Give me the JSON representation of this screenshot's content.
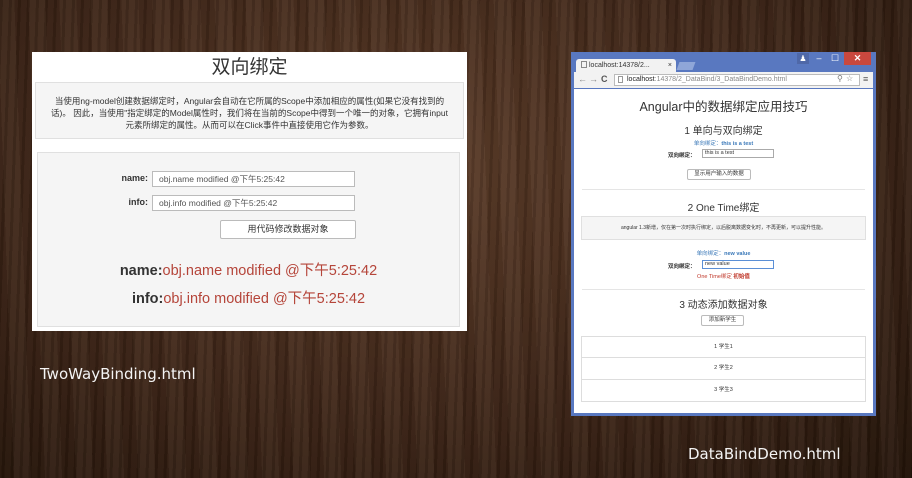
{
  "left_page": {
    "title": "双向绑定",
    "desc_line1": "当使用ng-model创建数据绑定时，Angular会自动在它所属的Scope中添加相应的属性(如果它没有找到的",
    "desc_line2": "话)。 因此，当使用\"指定绑定的Model属性时，我们将在当前的Scope中得到一个唯一的对象，它拥有input",
    "desc_line3": "元素所绑定的属性。从而可以在Click事件中直接使用它作为参数。",
    "name_label": "name:",
    "name_value": "obj.name modified @下午5:25:42",
    "info_label": "info:",
    "info_value": "obj.info modified @下午5:25:42",
    "button_label": "用代码修改数据对象",
    "display_name_label": "name:",
    "display_name_value": "obj.name modified @下午5:25:42",
    "display_info_label": "info:",
    "display_info_value": "obj.info modified @下午5:25:42",
    "value_color": "#b5453a"
  },
  "left_caption": "TwoWayBinding.html",
  "right_caption": "DataBindDemo.html",
  "browser": {
    "tab_title": "localhost:14378/2...",
    "tab_close": "×",
    "user_icon": "♟",
    "minimize": "–",
    "maximize": "☐",
    "close": "✕",
    "back": "←",
    "forward": "→",
    "reload": "C",
    "url_host": "localhost",
    "url_path": ":14378/2_DataBind/3_DataBindDemo.html",
    "search_glyph": "⚲",
    "star_glyph": "☆",
    "menu_glyph": "≡",
    "frame_color": "#5978c0"
  },
  "demo": {
    "title": "Angular中的数据绑定应用技巧",
    "section1_title": "1 单向与双向绑定",
    "s1_oneway_label": "单向绑定：",
    "s1_oneway_value": "this is a test",
    "s1_twoway_label": "双向绑定：",
    "s1_twoway_value": "this is a test",
    "s1_button": "显示用户输入的数据",
    "section2_title": "2 One Time绑定",
    "s2_note": "angular 1.3新增，仅在第一次时执行绑定，以后脱离数据变化时，不再更新，可以提升性能。",
    "s2_oneway_label": "单向绑定：",
    "s2_oneway_value": "new value",
    "s2_twoway_label": "双向绑定：",
    "s2_twoway_value": "new value",
    "s2_onetime_label": "One Time绑定",
    "s2_onetime_value": "初始值",
    "section3_title": "3 动态添加数据对象",
    "s3_button": "添加新学生",
    "students": [
      "1 学生1",
      "2 学生2",
      "3 学生3"
    ]
  }
}
